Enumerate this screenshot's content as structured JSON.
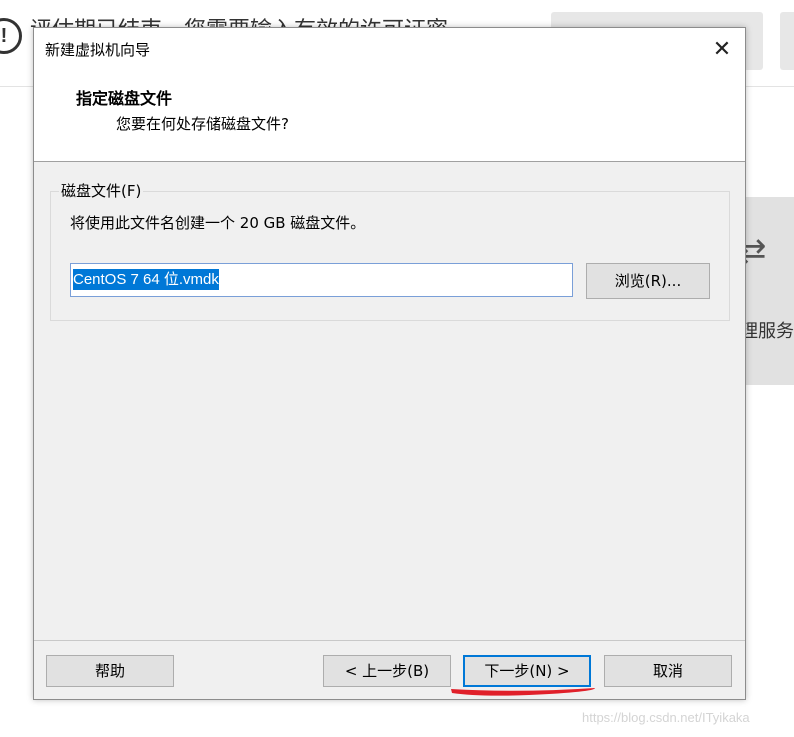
{
  "background": {
    "banner_text": "评估期已结束。您需要输入有效的许可证密",
    "panel_label": "理服务器",
    "watermark": "https://blog.csdn.net/ITyikaka",
    "warning_glyph": "!",
    "panel_glyph": "⇄"
  },
  "dialog": {
    "title": "新建虚拟机向导",
    "close_glyph": "✕",
    "header": {
      "title": "指定磁盘文件",
      "subtitle": "您要在何处存储磁盘文件?"
    },
    "group": {
      "legend": "磁盘文件(F)",
      "description": "将使用此文件名创建一个 20 GB 磁盘文件。",
      "file_value": "CentOS 7 64 位.vmdk",
      "browse_label": "浏览(R)..."
    },
    "footer": {
      "help_label": "帮助",
      "back_label": "< 上一步(B)",
      "next_label": "下一步(N) >",
      "cancel_label": "取消"
    }
  },
  "colors": {
    "selection": "#0078d7",
    "annotation": "#e0202a",
    "dialog_bg": "#f0f0f0"
  }
}
